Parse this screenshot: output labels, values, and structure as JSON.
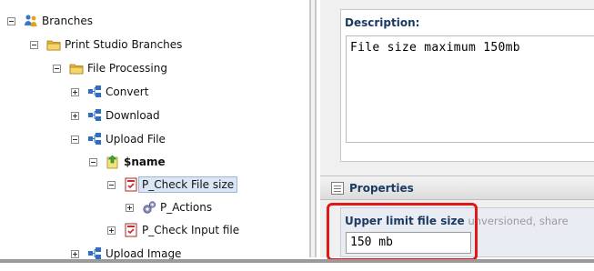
{
  "tree": {
    "root": {
      "label": "Branches",
      "icon": "people-icon"
    },
    "print_studio": {
      "label": "Print Studio Branches",
      "icon": "folder-icon"
    },
    "file_processing": {
      "label": "File Processing",
      "icon": "folder-icon"
    },
    "convert": {
      "label": "Convert",
      "icon": "workflow-icon"
    },
    "download": {
      "label": "Download",
      "icon": "workflow-icon"
    },
    "upload_file": {
      "label": "Upload File",
      "icon": "workflow-icon"
    },
    "name": {
      "label": "$name",
      "icon": "upload-node-icon"
    },
    "p_check_file_size": {
      "label": "P_Check File size",
      "icon": "check-document-icon",
      "selected": true
    },
    "p_actions": {
      "label": "P_Actions",
      "icon": "actions-gear-icon"
    },
    "p_check_input_file": {
      "label": "P_Check Input file",
      "icon": "check-document-icon"
    },
    "upload_image": {
      "label": "Upload Image",
      "icon": "workflow-icon"
    }
  },
  "description": {
    "title": "Description:",
    "value": "File size maximum 150mb"
  },
  "properties": {
    "title": "Properties",
    "field_label": "Upper limit file size",
    "field_meta": "unversioned, share",
    "field_value": "150 mb"
  },
  "colors": {
    "highlight": "#e01818",
    "title_blue": "#1b3a63",
    "selection": "#dbe6f5"
  }
}
